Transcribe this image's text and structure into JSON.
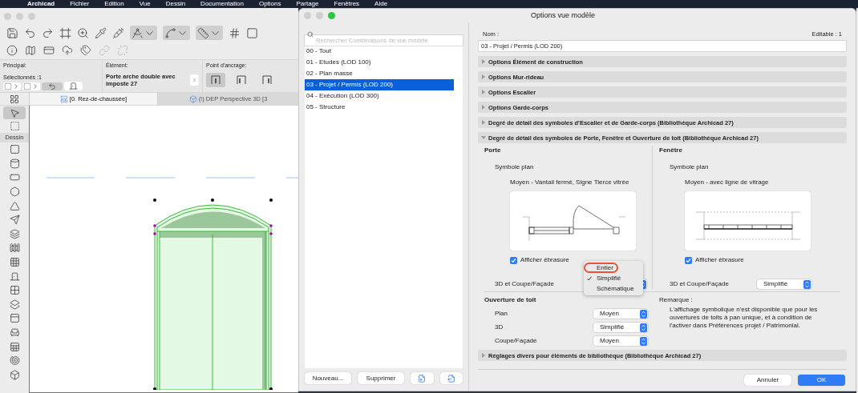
{
  "menu_bar": {
    "items": [
      "Archicad",
      "Fichier",
      "Edition",
      "Vue",
      "Dessin",
      "Documentation",
      "Options",
      "Partage",
      "Fenêtres",
      "Aide"
    ]
  },
  "main_window": {
    "info_box": {
      "principal_label": "Principal:",
      "selected_count": "Sélectionnés :1",
      "element_label": "Élément:",
      "element_name": "Porte arche double avec imposte 27",
      "anchor_label": "Point d'ancrage:",
      "anchor_points": [
        {
          "selected": true
        },
        {
          "selected": false
        },
        {
          "selected": false
        }
      ]
    },
    "view_tabs": [
      {
        "label": "[0. Rez-de-chaussée]",
        "selected": true,
        "kind": "plan"
      },
      {
        "label": "(!) DEP Perspective 3D [3",
        "selected": false,
        "kind": "perspective"
      }
    ],
    "toolbox": {
      "section": "Dessin"
    }
  },
  "dialog": {
    "title": "Options vue modèle",
    "search": {
      "placeholder": "Rechercher Combinaisons de vue modèle"
    },
    "combinations": [
      {
        "label": "00 - Tout",
        "selected": false
      },
      {
        "label": "01 - Etudes (LOD 100)",
        "selected": false
      },
      {
        "label": "02 - Plan masse",
        "selected": false
      },
      {
        "label": "03 - Projet / Permis (LOD 200)",
        "selected": true
      },
      {
        "label": "04 - Exécution (LOD 300)",
        "selected": false
      },
      {
        "label": "05 - Structure",
        "selected": false
      }
    ],
    "list_buttons": [
      "Nouveau...",
      "Supprimer"
    ],
    "name_label": "Nom :",
    "editable": "Editable : 1",
    "name_value": "03 - Projet / Permis (LOD 200)",
    "sections": [
      {
        "title": "Options Élément de construction",
        "expanded": false
      },
      {
        "title": "Options Mur-rideau",
        "expanded": false
      },
      {
        "title": "Options Escalier",
        "expanded": false
      },
      {
        "title": "Options Garde-corps",
        "expanded": false
      },
      {
        "title": "Degré de détail des symboles d'Escalier et de Garde-corps (Bibliothèque Archicad 27)",
        "expanded": false
      },
      {
        "title": "Degré de détail des symboles de Porte, Fenêtre et Ouverture de toit (Bibliothèque Archicad 27)",
        "expanded": true
      },
      {
        "title": "Réglages divers pour éléments de bibliothèque (Bibliothèque Archicad 27)",
        "expanded": false
      }
    ],
    "detail": {
      "door": {
        "heading": "Porte",
        "symbol_label": "Symbole plan",
        "symbol_value": "Moyen - Vantail fermé, Signe Tierce vitrée",
        "reveal": {
          "label": "Afficher ébrasure",
          "checked": true
        },
        "section_label": "3D et Coupe/Façade"
      },
      "window": {
        "heading": "Fenêtre",
        "symbol_label": "Symbole plan",
        "symbol_value": "Moyen - avec ligne de vitrage",
        "reveal": {
          "label": "Afficher ébrasure",
          "checked": true
        },
        "section_label": "3D et Coupe/Façade",
        "section_value": "Simplifié"
      },
      "roof_opening": {
        "heading": "Ouverture de toit",
        "rows": [
          {
            "label": "Plan",
            "value": "Moyen"
          },
          {
            "label": "3D",
            "value": "Simplifié"
          },
          {
            "label": "Coupe/Façade",
            "value": "Moyen"
          }
        ]
      },
      "remark": {
        "heading": "Remarque :",
        "text": "L'affichage symbolique n'est disponible que pour les ouvertures de toits à pan unique, et à condition de l'activer dans Préférences projet / Patrimonial."
      }
    },
    "popup_menu": {
      "items": [
        {
          "label": "Entier",
          "selected": false,
          "circled": true
        },
        {
          "label": "Simplifié",
          "selected": true,
          "circled": false
        },
        {
          "label": "Schématique",
          "selected": false,
          "circled": false
        }
      ]
    },
    "buttons": [
      {
        "label": "Annuler",
        "kind": "secondary"
      },
      {
        "label": "OK",
        "kind": "primary"
      }
    ]
  }
}
